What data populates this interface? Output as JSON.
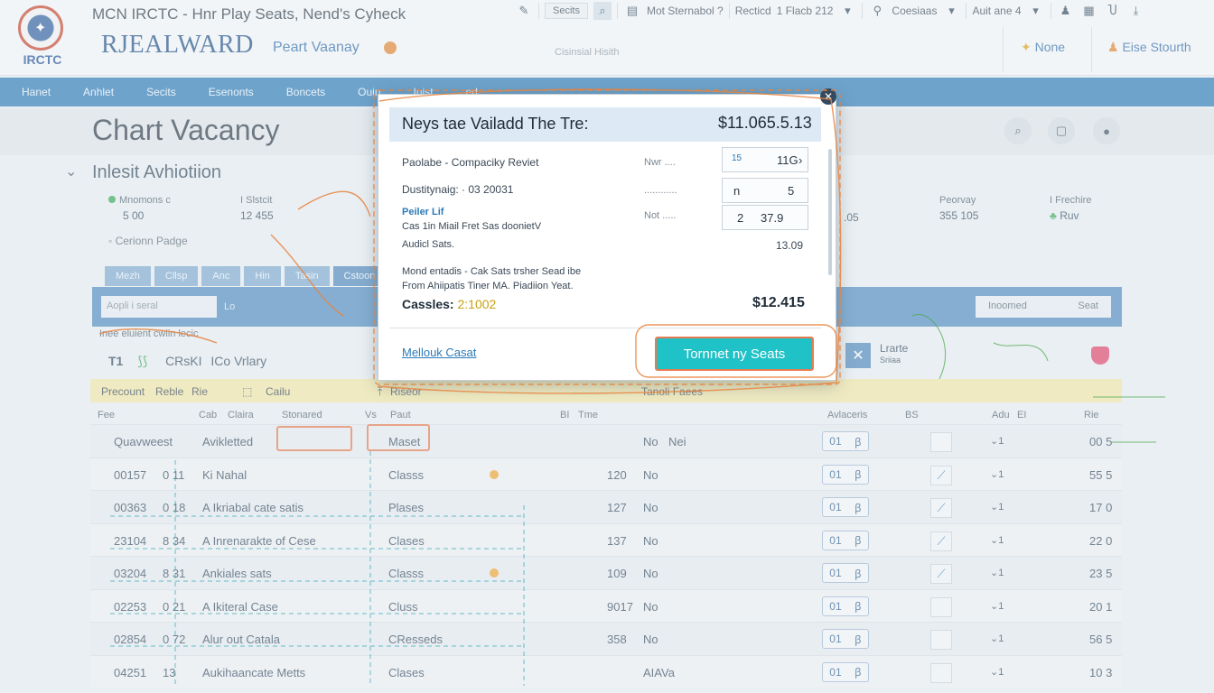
{
  "header": {
    "logo_text": "IRCTC",
    "app_title": "MCN IRCTC - Hnr Play Seats, Nend's Cyheck",
    "brand": "RJEALWARD",
    "brand_sub": "Peart Vaanay",
    "mid_text": "Cisinsial Hisith",
    "toolbar": {
      "search_box": "Secits",
      "help_text": "Mot Sternabol ?",
      "records": "Recticd",
      "pager": "1 Flacb 212",
      "user_label": "Coesiaas",
      "auth_label": "Auit ane 4"
    },
    "right_link1": "None",
    "right_link2": "Eise Stourth"
  },
  "nav": [
    "Hanet",
    "Anhlet",
    "Secits",
    "Esenonts",
    "Boncets",
    "Ouin",
    "Inist",
    "ed"
  ],
  "page": {
    "title": "Chart Vacancy",
    "section_title": "Inlesit Avhiotiion",
    "stats": [
      {
        "label": "Mnomons c",
        "value": "5 00"
      },
      {
        "label": "I Slstcit",
        "value": "12 455"
      },
      {
        "label": "",
        "value": ".05"
      },
      {
        "label": "Peorvay",
        "value": "355 105"
      },
      {
        "label": "I Frechire",
        "value": "Ruv"
      }
    ],
    "current_badge": "Cerionn Padge",
    "tabs": [
      "Mezh",
      "Cllsp",
      "Anc",
      "Hin",
      "Tasin",
      "Cstoon"
    ],
    "filter_placeholder": "Aopli i seral",
    "filter_link": "Lo",
    "sort_label": "Inoomed",
    "sort_value": "Seat",
    "sub_text": "Inee eluient cwiin lecic",
    "main_row": [
      "T1",
      "CRsKI",
      "ICo Vrlary"
    ],
    "later_text": [
      "Lrarte",
      "Sriiaa"
    ],
    "yellow": [
      "Precount",
      "Reble",
      "Rie",
      "Cailu",
      "Riseor",
      "Tanoli Faees"
    ]
  },
  "table": {
    "headers": [
      "Fee",
      "Cab",
      "Claira",
      "Stonared",
      "Vs",
      "Paut",
      "BI",
      "Tme",
      "Avlaceris",
      "BS",
      "Adu",
      "EI",
      "Rie"
    ],
    "rows": [
      {
        "id": "Quavweest",
        "num": "",
        "name": "Avikletted",
        "type": "Maset",
        "count": "",
        "status": "No",
        "status2": "Nei",
        "seat": "01",
        "total": "00 5"
      },
      {
        "id": "00157",
        "num": "0 11",
        "name": "Ki Nahal",
        "type": "Classs",
        "count": "120",
        "status": "No",
        "status2": "",
        "seat": "01",
        "total": "55 5"
      },
      {
        "id": "00363",
        "num": "0 18",
        "name": "A Ikriabal cate satis",
        "type": "Plases",
        "count": "127",
        "status": "No",
        "status2": "",
        "seat": "01",
        "total": "17 0"
      },
      {
        "id": "23104",
        "num": "8 34",
        "name": "A Inrenarakte of Cese",
        "type": "Clases",
        "count": "137",
        "status": "No",
        "status2": "",
        "seat": "01",
        "total": "22 0"
      },
      {
        "id": "03204",
        "num": "8 31",
        "name": "Ankiales sats",
        "type": "Classs",
        "count": "109",
        "status": "No",
        "status2": "",
        "seat": "01",
        "total": "23 5"
      },
      {
        "id": "02253",
        "num": "0 21",
        "name": "A Ikiteral Case",
        "type": "Cluss",
        "count": "9017",
        "status": "No",
        "status2": "",
        "seat": "01",
        "total": "20 1"
      },
      {
        "id": "02854",
        "num": "0 72",
        "name": "Alur out Catala",
        "type": "CResseds",
        "count": "358",
        "status": "No",
        "status2": "",
        "seat": "01",
        "total": "56 5"
      },
      {
        "id": "04251",
        "num": "13",
        "name": "Aukihaancate Metts",
        "type": "Clases",
        "count": "",
        "status": "AIAVa",
        "status2": "",
        "seat": "01",
        "total": "10 3"
      }
    ]
  },
  "modal": {
    "title": "Neys tae Vailadd The Tre:",
    "price": "$11.065.5.13",
    "line1": "Paolabe - Compaciky Reviet",
    "line1_faint": "Nwr ....",
    "box1": [
      "15",
      "11G"
    ],
    "line2": "Dustitynaig: · 03 20031",
    "line2_faint": "............",
    "box2": [
      "n",
      "5"
    ],
    "link_label": "Peiler Lif",
    "line3": "Cas 1in Miail Fret Sas doonietV",
    "line3_faint": "Not .....",
    "box3": [
      "2",
      "37.9"
    ],
    "line4": "Audicl Sats.",
    "value4": "13.09",
    "note1": "Mond entadis - Cak Sats trsher Sead ibe",
    "note2": "From Ahiipatis Tiner MA. Piadiion Yeat.",
    "total_label": "Cassles:",
    "total_code": "2:1002",
    "total": "$12.415",
    "cancel_link": "Mellouk Casat",
    "cta": "Tornnet ny Seats",
    "accent": "#1fc2c6"
  },
  "colors": {
    "nav": "#2c7ab5",
    "accent": "#1fc2c6",
    "outline": "#e67c52",
    "brand": "#1f4f86"
  }
}
